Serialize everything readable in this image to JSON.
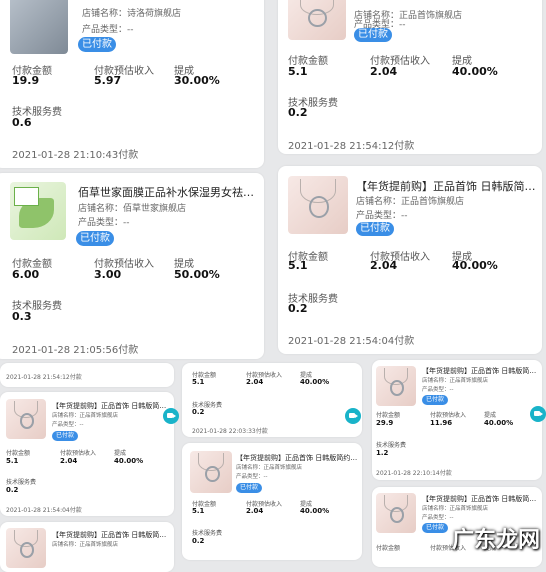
{
  "labels": {
    "paid_amount": "付款金额",
    "est_income": "付款预估收入",
    "commission": "提成",
    "service_fee": "技术服务费",
    "status": "已付款",
    "shop_prefix": "店铺名称：",
    "type_prefix": "产品类型：",
    "type_value": "--"
  },
  "orders": [
    {
      "title": "",
      "shop": "诗洛荷旗舰店",
      "amount": "19.9",
      "income": "5.97",
      "rate": "30.00%",
      "fee": "0.6",
      "time": "2021-01-28 21:10:43付款"
    },
    {
      "title": "",
      "shop": "正品首饰旗舰店",
      "amount": "5.1",
      "income": "2.04",
      "rate": "40.00%",
      "fee": "0.2",
      "time": "2021-01-28 21:54:12付款"
    },
    {
      "title": "佰草世家面膜正品补水保湿男女祛痘淡化痘...",
      "shop": "佰草世家旗舰店",
      "amount": "6.00",
      "income": "3.00",
      "rate": "50.00%",
      "fee": "0.3",
      "time": "2021-01-28 21:05:56付款"
    },
    {
      "title": "【年货提前购】正品首饰 日韩版简约吊坠+...",
      "shop": "正品首饰旗舰店",
      "amount": "5.1",
      "income": "2.04",
      "rate": "40.00%",
      "fee": "0.2",
      "time": "2021-01-28 21:54:04付款"
    },
    {
      "title": "【年货提前购】正品首饰 日韩版简约吊坠+...",
      "shop": "正品首饰旗舰店",
      "amount": "5.1",
      "income": "2.04",
      "rate": "40.00%",
      "fee": "0.2",
      "time": "2021-01-28 21:54:04付款"
    },
    {
      "title": "",
      "shop": "",
      "amount": "5.1",
      "income": "2.04",
      "rate": "40.00%",
      "fee": "0.2",
      "time": "2021-01-28 22:03:33付款"
    },
    {
      "title": "【年货提前购】正品首饰 日韩版简约吊坠+...",
      "shop": "正品首饰旗舰店",
      "amount": "5.1",
      "income": "2.04",
      "rate": "40.00%",
      "fee": "0.2",
      "time": ""
    },
    {
      "title": "【年货提前购】正品首饰 日韩版简约吊坠+...",
      "shop": "正品首饰旗舰店",
      "amount": "29.9",
      "income": "11.96",
      "rate": "40.00%",
      "fee": "1.2",
      "time": "2021-01-28 22:10:14付款"
    },
    {
      "title": "【年货提前购】正品首饰 日韩版简约吊坠+...",
      "shop": "正品首饰旗舰店",
      "amount": "",
      "income": "",
      "rate": "",
      "fee": "",
      "time": ""
    },
    {
      "title": "【年货提前购】正品首饰 日韩版简约吊坠+...",
      "shop": "正品首饰旗舰店",
      "amount": "",
      "income": "",
      "rate": "",
      "fee": "",
      "time": ""
    }
  ],
  "footer_time": "2021-01-28 21:54:12付款",
  "watermark": "广东龙网"
}
